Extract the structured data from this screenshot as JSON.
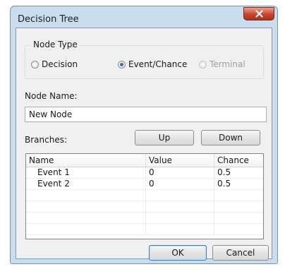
{
  "window": {
    "title": "Decision Tree",
    "close_glyph": "✕"
  },
  "node_type": {
    "group_label": "Node Type",
    "options": [
      {
        "label": "Decision",
        "checked": false,
        "enabled": true
      },
      {
        "label": "Event/Chance",
        "checked": true,
        "enabled": true
      },
      {
        "label": "Terminal",
        "checked": false,
        "enabled": false
      }
    ]
  },
  "node_name": {
    "label": "Node Name:",
    "value": "New Node"
  },
  "branches": {
    "label": "Branches:",
    "up_label": "Up",
    "down_label": "Down",
    "columns": [
      "Name",
      "Value",
      "Chance"
    ],
    "rows": [
      [
        "Event 1",
        "0",
        "0.5"
      ],
      [
        "Event 2",
        "0",
        "0.5"
      ],
      [
        "",
        "",
        ""
      ],
      [
        "",
        "",
        ""
      ],
      [
        "",
        "",
        ""
      ],
      [
        "",
        "",
        ""
      ]
    ]
  },
  "footer": {
    "ok_label": "OK",
    "cancel_label": "Cancel"
  },
  "colors": {
    "frame": "#c9ddef",
    "client": "#f0f0f0",
    "close_button": "#c9452d",
    "radio_selected": "#2d6fc2"
  }
}
